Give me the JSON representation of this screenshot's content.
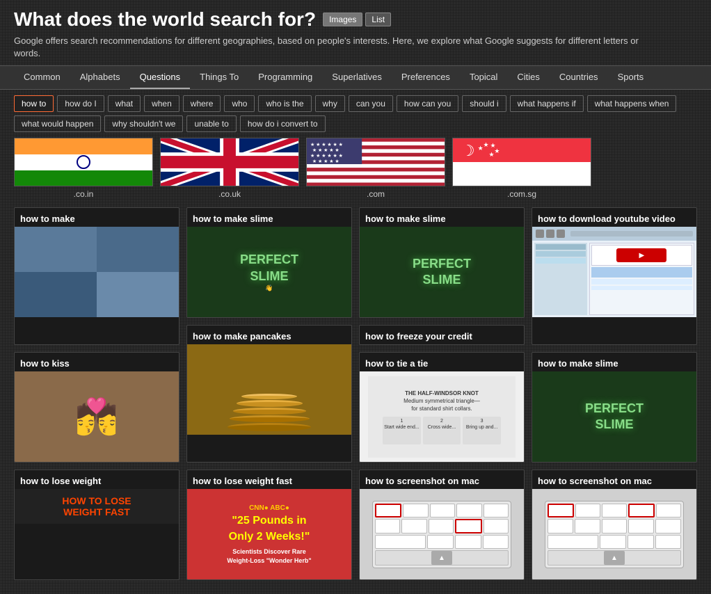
{
  "header": {
    "title": "What does the world search for?",
    "desc": "Google offers search recommendations for different geographies, based on people's interests. Here, we explore what Google suggests for different letters or words.",
    "btn_images": "Images",
    "btn_list": "List"
  },
  "nav": {
    "items": [
      {
        "label": "Common",
        "active": false
      },
      {
        "label": "Alphabets",
        "active": false
      },
      {
        "label": "Questions",
        "active": false
      },
      {
        "label": "Things To",
        "active": false
      },
      {
        "label": "Programming",
        "active": false
      },
      {
        "label": "Superlatives",
        "active": false
      },
      {
        "label": "Preferences",
        "active": false
      },
      {
        "label": "Topical",
        "active": false
      },
      {
        "label": "Cities",
        "active": false
      },
      {
        "label": "Countries",
        "active": false
      },
      {
        "label": "Sports",
        "active": false
      }
    ]
  },
  "filters": {
    "items": [
      {
        "label": "how to",
        "active": true
      },
      {
        "label": "how do I",
        "active": false
      },
      {
        "label": "what",
        "active": false
      },
      {
        "label": "when",
        "active": false
      },
      {
        "label": "where",
        "active": false
      },
      {
        "label": "who",
        "active": false
      },
      {
        "label": "who is the",
        "active": false
      },
      {
        "label": "why",
        "active": false
      },
      {
        "label": "can you",
        "active": false
      },
      {
        "label": "how can you",
        "active": false
      },
      {
        "label": "should i",
        "active": false
      },
      {
        "label": "what happens if",
        "active": false
      },
      {
        "label": "what happens when",
        "active": false
      },
      {
        "label": "what would happen",
        "active": false
      },
      {
        "label": "why shouldn't we",
        "active": false
      },
      {
        "label": "unable to",
        "active": false
      },
      {
        "label": "how do i convert to",
        "active": false
      }
    ]
  },
  "flags": [
    {
      "domain": ".co.in",
      "country": "India"
    },
    {
      "domain": ".co.uk",
      "country": "United Kingdom"
    },
    {
      "domain": ".com",
      "country": "United States"
    },
    {
      "domain": ".com.sg",
      "country": "Singapore"
    }
  ],
  "cards": [
    {
      "title": "how to make",
      "col": 1,
      "row": 1,
      "type": "yarn"
    },
    {
      "title": "how to make slime",
      "col": 2,
      "row": 1,
      "type": "slime"
    },
    {
      "title": "how to make slime",
      "col": 3,
      "row": 1,
      "type": "slime"
    },
    {
      "title": "how to download youtube video",
      "col": 4,
      "row": 1,
      "type": "download"
    },
    {
      "title": "how to kiss",
      "col": 1,
      "row": 2,
      "type": "kiss"
    },
    {
      "title": "how to make pancakes",
      "col": 2,
      "row": 2,
      "type": "pancakes"
    },
    {
      "title": "how to freeze your credit",
      "col": 3,
      "row": 2,
      "type": "freeze"
    },
    {
      "title": "how to make slime",
      "col": 4,
      "row": 2,
      "type": "slime"
    },
    {
      "title": "how to tie a tie",
      "col": 3,
      "row": 3,
      "type": "tie"
    },
    {
      "title": "how to lose weight",
      "col": 1,
      "row": 3,
      "type": "loseweight"
    },
    {
      "title": "how to lose weight fast",
      "col": 2,
      "row": 3,
      "type": "loseweightfast"
    },
    {
      "title": "how to screenshot on mac",
      "col": 3,
      "row": 4,
      "type": "screenshot"
    },
    {
      "title": "how to screenshot on mac",
      "col": 4,
      "row": 4,
      "type": "screenshot2"
    }
  ],
  "slime_text": "PERFECT\nSLIME",
  "pancake_text": "🥞",
  "weight_text_big": "\"25 Pounds in Only 2 Weeks!\"",
  "weight_text_small": "Scientists Discover Rare Weight-Loss \"Wonder Herb\""
}
